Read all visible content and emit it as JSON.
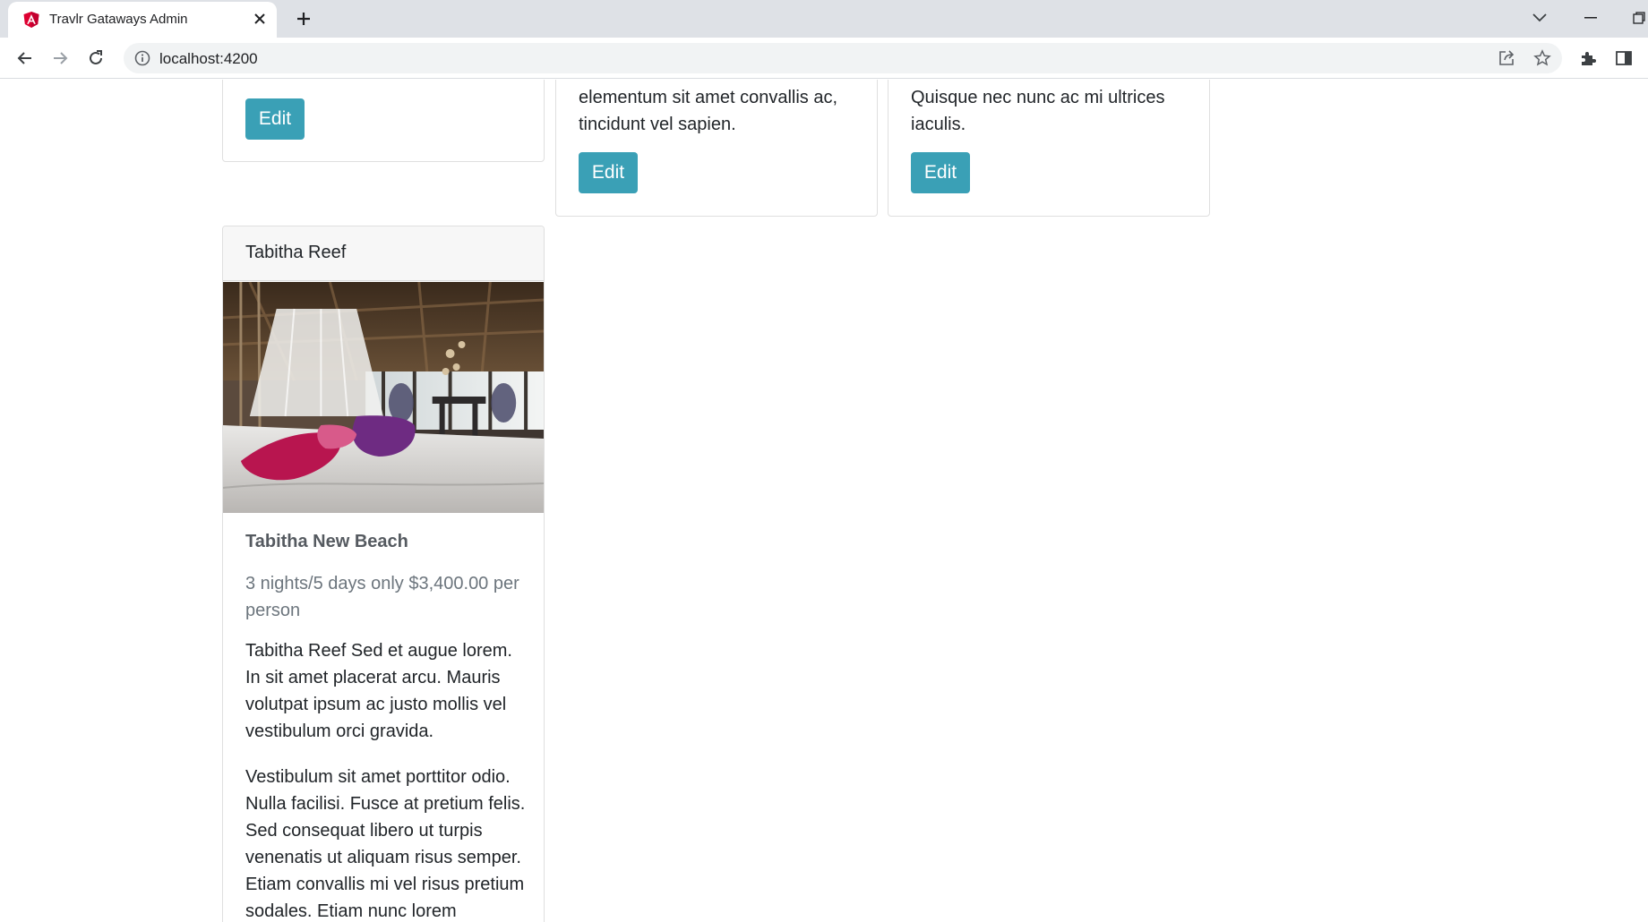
{
  "browser": {
    "tab_title": "Travlr Gataways Admin",
    "url": "localhost:4200",
    "colors": {
      "tabstrip": "#dee1e6",
      "favicon": "#dd0031"
    }
  },
  "cards_top": [
    {
      "description_lines": [],
      "edit_label": "Edit"
    },
    {
      "description": "elementum sit amet convallis ac, tincidunt vel sapien.",
      "edit_label": "Edit"
    },
    {
      "description": "Quisque nec nunc ac mi ultrices iaculis.",
      "edit_label": "Edit"
    }
  ],
  "trip_card": {
    "header": "Tabitha Reef",
    "image_alt": "resort bedroom with canopy bed",
    "title": "Tabitha New Beach",
    "subtitle": "3 nights/5 days only $3,400.00 per person",
    "paragraph1": "Tabitha Reef Sed et augue lorem. In sit amet placerat arcu. Mauris volutpat ipsum ac justo mollis vel vestibulum orci gravida.",
    "paragraph2": "Vestibulum sit amet porttitor odio. Nulla facilisi. Fusce at pretium felis. Sed consequat libero ut turpis venenatis ut aliquam risus semper. Etiam convallis mi vel risus pretium sodales. Etiam nunc lorem"
  },
  "theme": {
    "button_color": "#3aa0b6"
  }
}
